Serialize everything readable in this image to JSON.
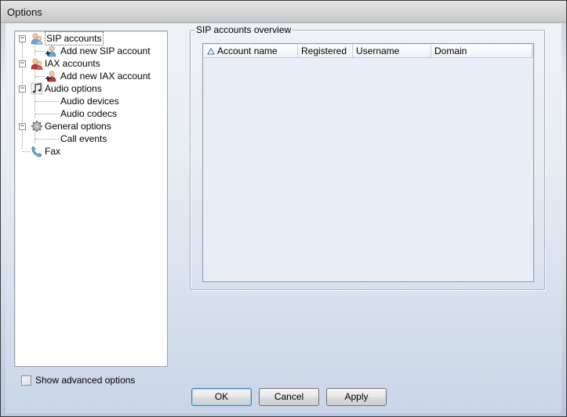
{
  "window": {
    "title": "Options"
  },
  "tree": {
    "items": [
      {
        "label": "SIP accounts",
        "icon": "sip-accounts-icon",
        "selected": true
      },
      {
        "label": "Add new SIP account",
        "icon": "add-sip-account-icon"
      },
      {
        "label": "IAX accounts",
        "icon": "iax-accounts-icon"
      },
      {
        "label": "Add new IAX account",
        "icon": "add-iax-account-icon"
      },
      {
        "label": "Audio options",
        "icon": "music-note-icon"
      },
      {
        "label": "Audio devices"
      },
      {
        "label": "Audio codecs"
      },
      {
        "label": "General options",
        "icon": "gear-icon"
      },
      {
        "label": "Call events"
      },
      {
        "label": "Fax",
        "icon": "fax-phone-icon"
      }
    ]
  },
  "sip_overview": {
    "group_title": "SIP accounts overview",
    "columns": [
      "Account name",
      "Registered",
      "Username",
      "Domain"
    ],
    "rows": []
  },
  "advanced": {
    "label": "Show advanced options",
    "checked": false
  },
  "buttons": {
    "ok": "OK",
    "cancel": "Cancel",
    "apply": "Apply"
  },
  "colors": {
    "selection_accent": "#3c7fb1",
    "sip_icon": "#6aa7d8",
    "iax_icon": "#c83232"
  }
}
